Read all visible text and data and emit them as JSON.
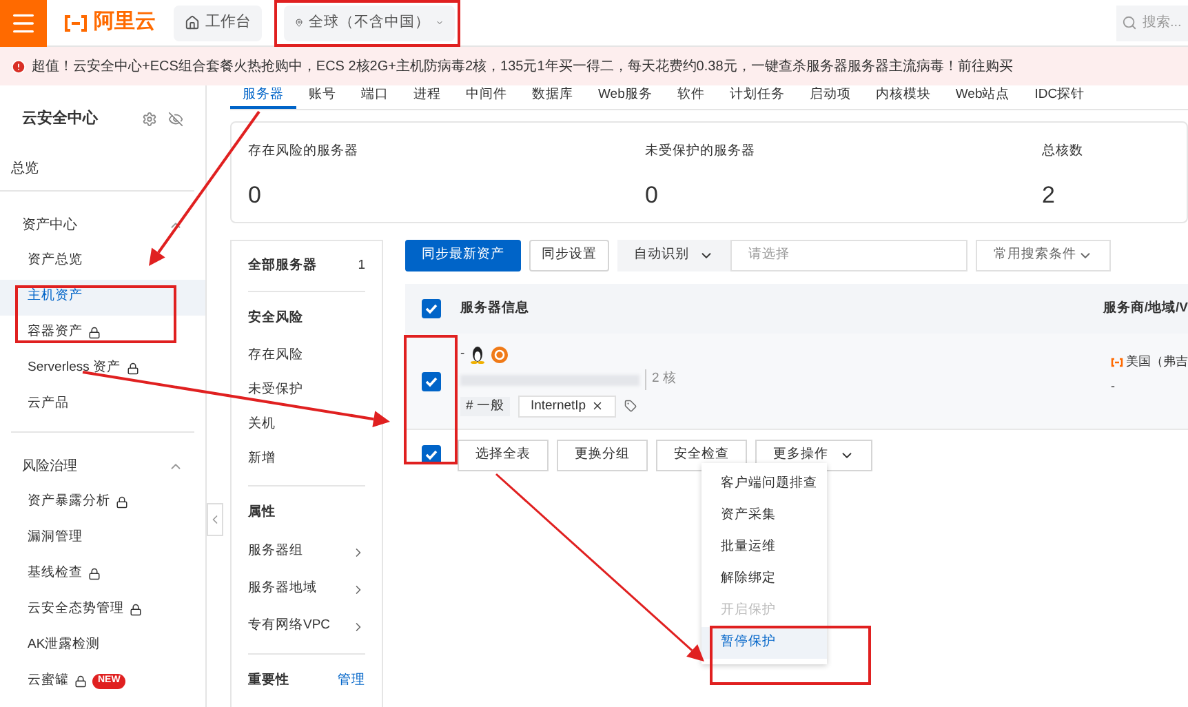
{
  "topbar": {
    "logo_text": "阿里云",
    "workbench": "工作台",
    "region": "全球（不含中国）",
    "search_placeholder": "搜索..."
  },
  "banner": {
    "text": "超值！云安全中心+ECS组合套餐火热抢购中，ECS 2核2G+主机防病毒2核，135元1年买一得二，每天花费约0.38元，一键查杀服务器服务器主流病毒！前往购买"
  },
  "sidebar": {
    "title": "云安全中心",
    "overview": "总览",
    "sections": [
      {
        "title": "资产中心",
        "expanded": true,
        "items": [
          {
            "label": "资产总览",
            "selected": false,
            "locked": false
          },
          {
            "label": "主机资产",
            "selected": true,
            "locked": false
          },
          {
            "label": "容器资产",
            "selected": false,
            "locked": true
          },
          {
            "label": "Serverless 资产",
            "selected": false,
            "locked": true
          },
          {
            "label": "云产品",
            "selected": false,
            "locked": false
          }
        ]
      },
      {
        "title": "风险治理",
        "expanded": true,
        "items": [
          {
            "label": "资产暴露分析",
            "selected": false,
            "locked": true
          },
          {
            "label": "漏洞管理",
            "selected": false,
            "locked": false
          },
          {
            "label": "基线检查",
            "selected": false,
            "locked": true
          },
          {
            "label": "云安全态势管理",
            "selected": false,
            "locked": true
          },
          {
            "label": "AK泄露检测",
            "selected": false,
            "locked": false
          },
          {
            "label": "云蜜罐",
            "selected": false,
            "locked": true,
            "badge": "NEW"
          }
        ]
      }
    ]
  },
  "tabs": [
    {
      "label": "服务器",
      "selected": true
    },
    {
      "label": "账号",
      "selected": false
    },
    {
      "label": "端口",
      "selected": false
    },
    {
      "label": "进程",
      "selected": false
    },
    {
      "label": "中间件",
      "selected": false
    },
    {
      "label": "数据库",
      "selected": false
    },
    {
      "label": "Web服务",
      "selected": false
    },
    {
      "label": "软件",
      "selected": false
    },
    {
      "label": "计划任务",
      "selected": false
    },
    {
      "label": "启动项",
      "selected": false
    },
    {
      "label": "内核模块",
      "selected": false
    },
    {
      "label": "Web站点",
      "selected": false
    },
    {
      "label": "IDC探针",
      "selected": false
    }
  ],
  "stats": [
    {
      "label": "存在风险的服务器",
      "value": "0"
    },
    {
      "label": "未受保护的服务器",
      "value": "0"
    },
    {
      "label": "总核数",
      "value": "2"
    }
  ],
  "filter_panel": {
    "all": {
      "label": "全部服务器",
      "count": "1"
    },
    "groups": [
      {
        "title": "安全风险",
        "items": [
          {
            "label": "存在风险",
            "submenu": false
          },
          {
            "label": "未受保护",
            "submenu": false
          },
          {
            "label": "关机",
            "submenu": false
          },
          {
            "label": "新增",
            "submenu": false
          }
        ]
      },
      {
        "title": "属性",
        "items": [
          {
            "label": "服务器组",
            "submenu": true
          },
          {
            "label": "服务器地域",
            "submenu": true
          },
          {
            "label": "专有网络VPC",
            "submenu": true
          }
        ]
      },
      {
        "title": "重要性",
        "action": "管理"
      }
    ]
  },
  "toolbar": {
    "sync_button": "同步最新资产",
    "settings_button": "同步设置",
    "search_type": "自动识别",
    "search_placeholder": "请选择",
    "common_filters": "常用搜索条件"
  },
  "table": {
    "columns": [
      "服务器信息",
      "服务商/地域/V"
    ],
    "header_checked": true,
    "rows": [
      {
        "checked": true,
        "prefix": "-",
        "cores": "2 核",
        "group": "# 一般",
        "tag": "InternetIp",
        "provider_region": "美国（弗吉",
        "status": "-"
      }
    ]
  },
  "bulk_actions": {
    "checked": true,
    "buttons": [
      "选择全表",
      "更换分组",
      "安全检查"
    ],
    "more": "更多操作"
  },
  "more_menu": [
    {
      "label": "客户端问题排查",
      "disabled": false,
      "selected": false
    },
    {
      "label": "资产采集",
      "disabled": false,
      "selected": false
    },
    {
      "label": "批量运维",
      "disabled": false,
      "selected": false
    },
    {
      "label": "解除绑定",
      "disabled": false,
      "selected": false
    },
    {
      "label": "开启保护",
      "disabled": true,
      "selected": false
    },
    {
      "label": "暂停保护",
      "disabled": false,
      "selected": true
    }
  ]
}
